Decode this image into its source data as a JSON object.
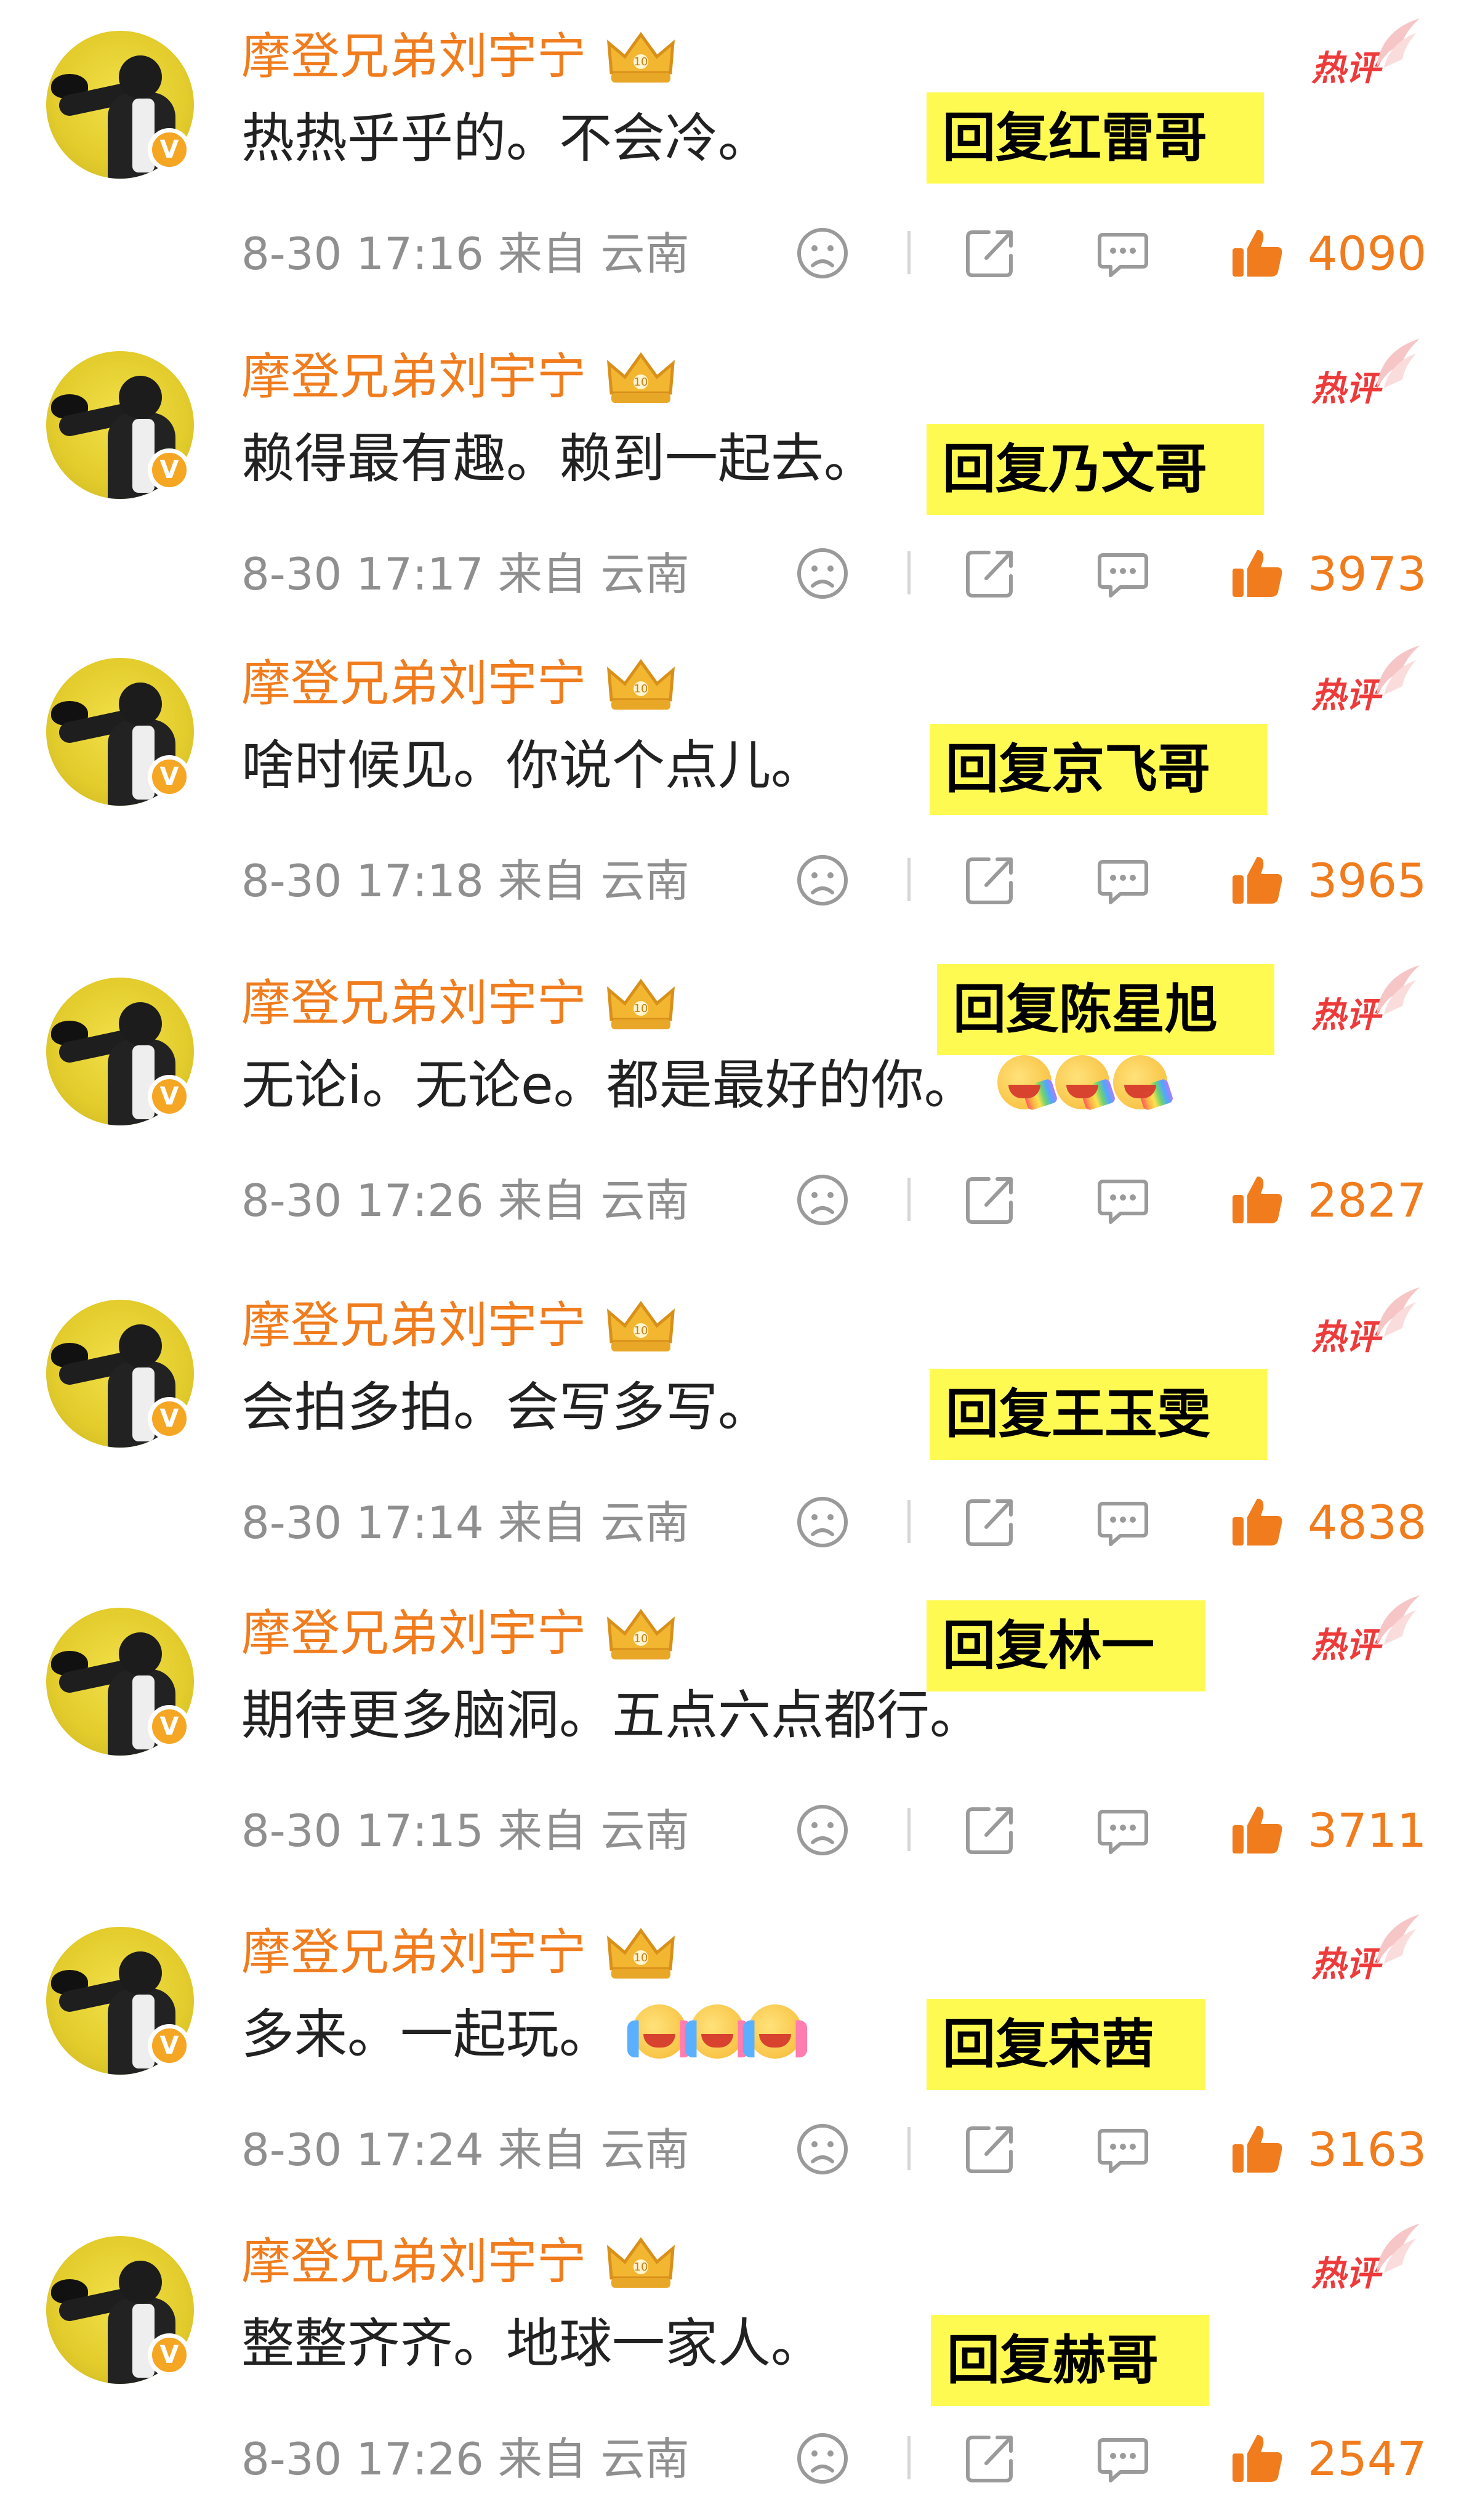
{
  "username": "摩登兄弟刘宇宁",
  "verified_badge": "V",
  "hot_label": "热评",
  "icons": {
    "avatar": "user-avatar",
    "crown": "crown-icon",
    "hot": "hot-comment-icon",
    "dislike": "sad-face-icon",
    "share": "share-icon",
    "comment": "comment-icon",
    "like": "thumbs-up-icon"
  },
  "colors": {
    "username": "#f07c1d",
    "reply_highlight": "#fffa52",
    "hot": "#ee3a3a",
    "like": "#f07c1d",
    "meta": "#8f8f8f"
  },
  "comments": [
    {
      "content": "热热乎乎的。不会冷。",
      "reply": "回复红雷哥",
      "time": "8-30 17:16",
      "source": "来自 云南",
      "likes": "4090",
      "emojis": []
    },
    {
      "content": "赖得最有趣。赖到一起去。",
      "reply": "回复乃文哥",
      "time": "8-30 17:17",
      "source": "来自 云南",
      "likes": "3973",
      "emojis": []
    },
    {
      "content": "啥时候见。你说个点儿。",
      "reply": "回复京飞哥",
      "time": "8-30 17:18",
      "source": "来自 云南",
      "likes": "3965",
      "emojis": []
    },
    {
      "content": "无论i。无论e。都是最好的你。",
      "reply": "回复陈星旭",
      "time": "8-30 17:26",
      "source": "来自 云南",
      "likes": "2827",
      "emojis": [
        "rainbow-face",
        "rainbow-face",
        "rainbow-face"
      ]
    },
    {
      "content": "会拍多拍。会写多写。",
      "reply": "回复王玉雯",
      "time": "8-30 17:14",
      "source": "来自 云南",
      "likes": "4838",
      "emojis": []
    },
    {
      "content": "期待更多脑洞。五点六点都行。",
      "reply": "回复林一",
      "time": "8-30 17:15",
      "source": "来自 云南",
      "likes": "3711",
      "emojis": []
    },
    {
      "content": "多来。一起玩。",
      "reply": "回复宋茜",
      "time": "8-30 17:24",
      "source": "来自 云南",
      "likes": "3163",
      "emojis": [
        "cheering-face",
        "cheering-face",
        "cheering-face"
      ]
    },
    {
      "content": "整整齐齐。地球一家人。",
      "reply": "回复赫哥",
      "time": "8-30 17:26",
      "source": "来自 云南",
      "likes": "2547",
      "emojis": []
    }
  ]
}
